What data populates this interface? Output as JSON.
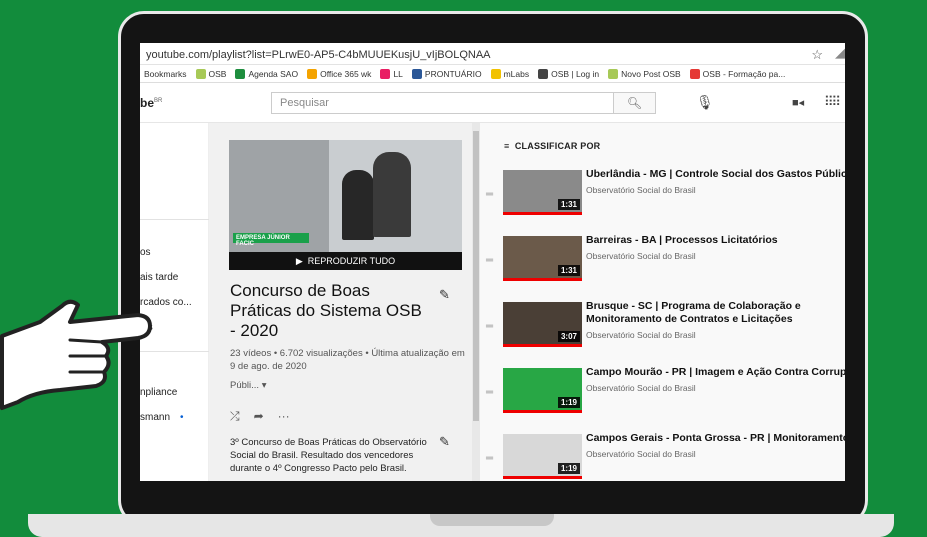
{
  "browser": {
    "url": "youtube.com/playlist?list=PLrwE0-AP5-C4bMUUEKusjU_vIjBOLQNAA"
  },
  "bookmarks": [
    {
      "label": "Bookmarks",
      "color": "#e0e0e0"
    },
    {
      "label": "OSB",
      "color": "#a7c957"
    },
    {
      "label": "Agenda SAO",
      "color": "#1e8e3e"
    },
    {
      "label": "Office 365 wk",
      "color": "#f4a300"
    },
    {
      "label": "LL",
      "color": "#e91e63"
    },
    {
      "label": "PRONTUÁRIO",
      "color": "#2b5797"
    },
    {
      "label": "mLabs",
      "color": "#f2c200"
    },
    {
      "label": "OSB | Log in",
      "color": "#444444"
    },
    {
      "label": "Novo Post OSB",
      "color": "#a7c957"
    },
    {
      "label": "OSB - Formação pa...",
      "color": "#e53935"
    }
  ],
  "youtube": {
    "logo": "be",
    "region": "BR",
    "search_placeholder": "Pesquisar"
  },
  "sidebar": {
    "items": [
      "os",
      "ais tarde",
      "rcados co...",
      "ais",
      "npliance",
      "smann"
    ]
  },
  "playlist": {
    "play_all": "REPRODUZIR TUDO",
    "thumb_caption": "EMPRESA JÚNIOR FACIC",
    "title": "Concurso de Boas Práticas do Sistema OSB - 2020",
    "stats": "23 vídeos • 6.702 visualizações • Última atualização em 9 de ago. de 2020",
    "privacy": "Públi...",
    "description": "3º Concurso de Boas Práticas do Observatório Social do Brasil. Resultado dos vencedores durante o 4º Congresso Pacto pelo Brasil."
  },
  "sort_label": "CLASSIFICAR POR",
  "videos": [
    {
      "title": "Uberlândia - MG | Controle Social dos Gastos Públicos",
      "channel": "Observatório Social do Brasil",
      "duration": "1:31",
      "thumb_color": "#8a8a8a"
    },
    {
      "title": "Barreiras - BA | Processos Licitatórios",
      "channel": "Observatório Social do Brasil",
      "duration": "1:31",
      "thumb_color": "#6b5a4a"
    },
    {
      "title": "Brusque - SC | Programa de Colaboração e Monitoramento de Contratos e Licitações",
      "channel": "Observatório Social do Brasil",
      "duration": "3:07",
      "thumb_color": "#4a3f36"
    },
    {
      "title": "Campo Mourão - PR | Imagem e Ação Contra Corrupção",
      "channel": "Observatório Social do Brasil",
      "duration": "1:19",
      "thumb_color": "#28a745"
    },
    {
      "title": "Campos Gerais - Ponta Grossa - PR | Monitoramento Legislativo",
      "channel": "Observatório Social do Brasil",
      "duration": "1:19",
      "thumb_color": "#d8d8d8"
    }
  ]
}
